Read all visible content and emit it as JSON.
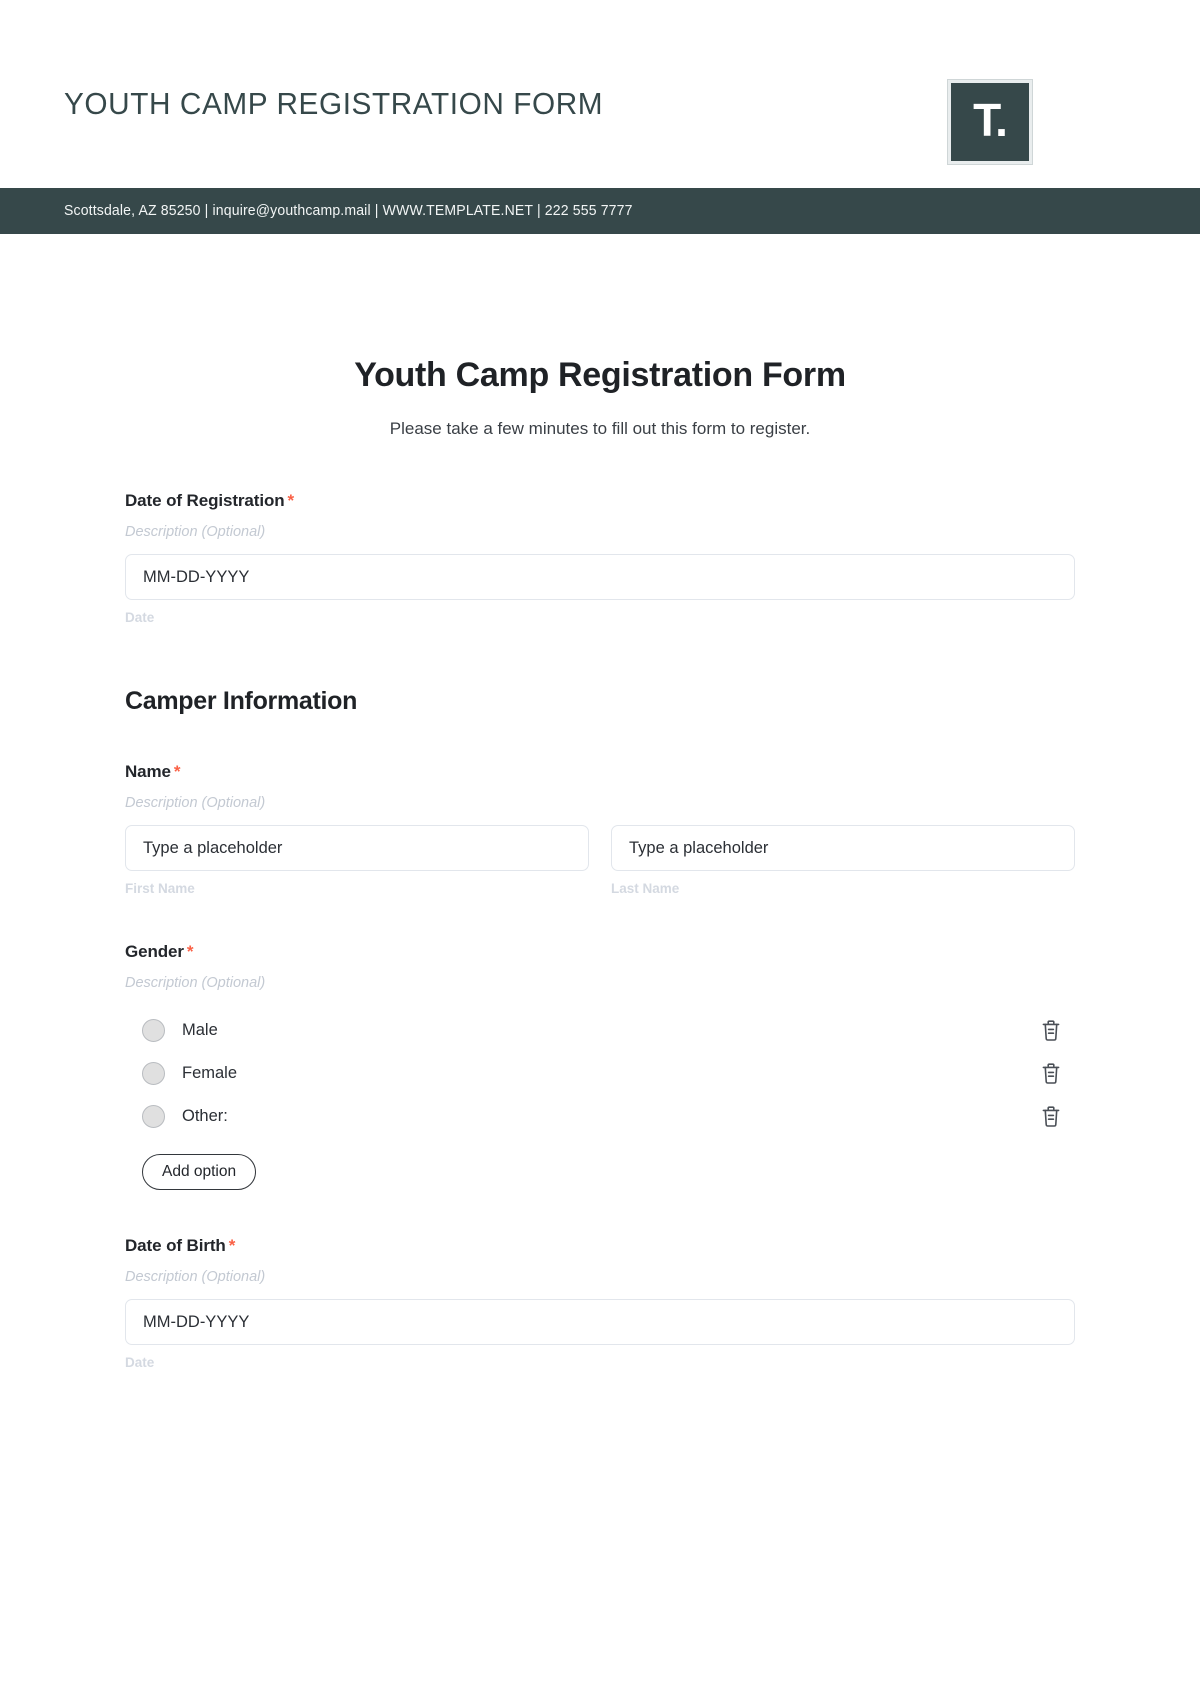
{
  "letterhead": {
    "title": "YOUTH CAMP REGISTRATION FORM",
    "logo_glyph": "T.",
    "contact": "Scottsdale, AZ 85250 | inquire@youthcamp.mail | WWW.TEMPLATE.NET | 222 555 7777"
  },
  "colors": {
    "brand_dark": "#36484a",
    "required_asterisk": "#fa6045",
    "placeholder_gray": "#c3c9d2"
  },
  "form": {
    "title": "Youth Camp Registration Form",
    "subtitle": "Please take a few minutes to fill out this form to register.",
    "description_placeholder": "Description (Optional)",
    "required_mark": "*",
    "fields": [
      {
        "label": "Date of Registration",
        "required": true,
        "description": "Description (Optional)",
        "value": "MM-DD-YYYY",
        "sublabel": "Date"
      },
      {
        "label": "Name",
        "required": true,
        "description": "Description (Optional)",
        "inputs": [
          {
            "value": "Type a placeholder",
            "sublabel": "First Name"
          },
          {
            "value": "Type a placeholder",
            "sublabel": "Last Name"
          }
        ]
      },
      {
        "label": "Gender",
        "required": true,
        "description": "Description (Optional)",
        "options": [
          "Male",
          "Female",
          "Other:"
        ],
        "add_option_label": "Add option"
      },
      {
        "label": "Date of Birth",
        "required": true,
        "description": "Description (Optional)",
        "value": "MM-DD-YYYY",
        "sublabel": "Date"
      }
    ],
    "section_heading": "Camper Information"
  }
}
